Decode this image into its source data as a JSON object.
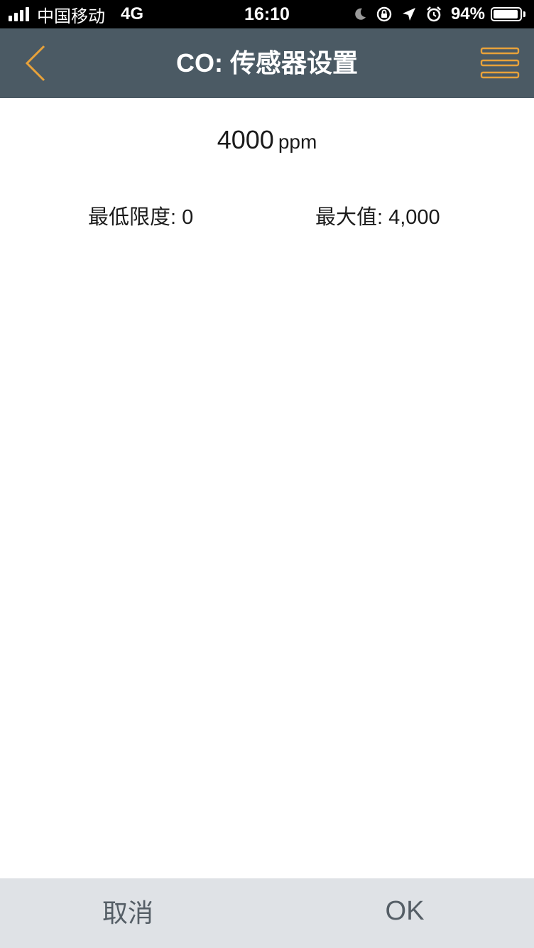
{
  "status_bar": {
    "carrier": "中国移动",
    "network": "4G",
    "time": "16:10",
    "battery_percent_label": "94%",
    "battery_level": 0.94,
    "icons": [
      "signal-icon",
      "moon-icon",
      "orientation-lock-icon",
      "location-icon",
      "alarm-icon",
      "battery-icon"
    ]
  },
  "nav": {
    "title": "CO: 传感器设置",
    "back_icon": "chevron-left-icon",
    "menu_icon": "hamburger-menu-icon"
  },
  "reading": {
    "value": "4000",
    "unit": "ppm"
  },
  "limits": {
    "min_text": "最低限度: 0",
    "max_text": "最大值: 4,000"
  },
  "actions": {
    "cancel_label": "取消",
    "ok_label": "OK"
  },
  "colors": {
    "nav_background": "#4b5a64",
    "accent": "#e8a23a",
    "action_bar_background": "#dfe2e6",
    "action_text": "#555e66"
  }
}
